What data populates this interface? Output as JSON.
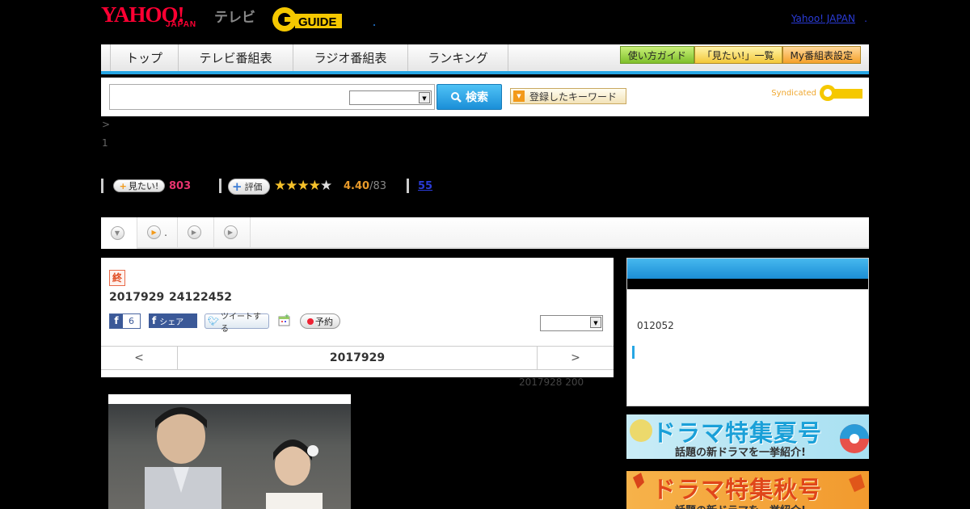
{
  "header": {
    "yahoo_logo": "YAHOO!",
    "japan_logo": "JAPAN",
    "tv_label": "テレビ",
    "gguide_logo": "GUIDE",
    "yahoo_japan_link": "Yahoo! JAPAN",
    "yahoo_japan_dot": "."
  },
  "nav": {
    "tabs": [
      {
        "label": "トップ"
      },
      {
        "label": "テレビ番組表"
      },
      {
        "label": "ラジオ番組表"
      },
      {
        "label": "ランキング"
      }
    ],
    "buttons": [
      {
        "label": "使い方ガイド",
        "color": "#8fcf3a"
      },
      {
        "label": "「見たい!」一覧",
        "color": "#f3c83a"
      },
      {
        "label": "My番組表設定",
        "color": "#f5a12a"
      }
    ],
    "accent": "#26a6e4"
  },
  "search": {
    "query": "",
    "select_value": "",
    "search_button": "検索",
    "keyword_button": "登録したキーワード",
    "syndicated": "Syndicated"
  },
  "breadcrumb": {
    "separator": ">",
    "count": "1"
  },
  "stats": {
    "mitai_label": "見たい!",
    "mitai_count": "803",
    "eval_label": "評価",
    "rating": 4.4,
    "rating_text": "4.40",
    "rating_count": "/83",
    "review_count": "55"
  },
  "subtabs": [
    {
      "label": ""
    },
    {
      "label": "."
    },
    {
      "label": ""
    },
    {
      "label": ""
    }
  ],
  "program": {
    "end_badge": "終",
    "air_date": "2017929",
    "air_time": "24122452",
    "fb_like_count": "6",
    "fb_share_label": "シェア",
    "tweet_label": "ツイートする",
    "record_label": "予約",
    "select_value": "",
    "date_nav": {
      "prev": "<",
      "date": "2017929",
      "next": ">"
    },
    "broadcast_note": "2017928  200"
  },
  "side": {
    "number": "012052"
  },
  "banners": {
    "summer": {
      "title": "ドラマ特集夏号",
      "subtitle": "話題の新ドラマを一挙紹介!"
    },
    "autumn": {
      "title": "ドラマ特集秋号",
      "subtitle": "話題の新ドラマを一挙紹介!"
    }
  }
}
